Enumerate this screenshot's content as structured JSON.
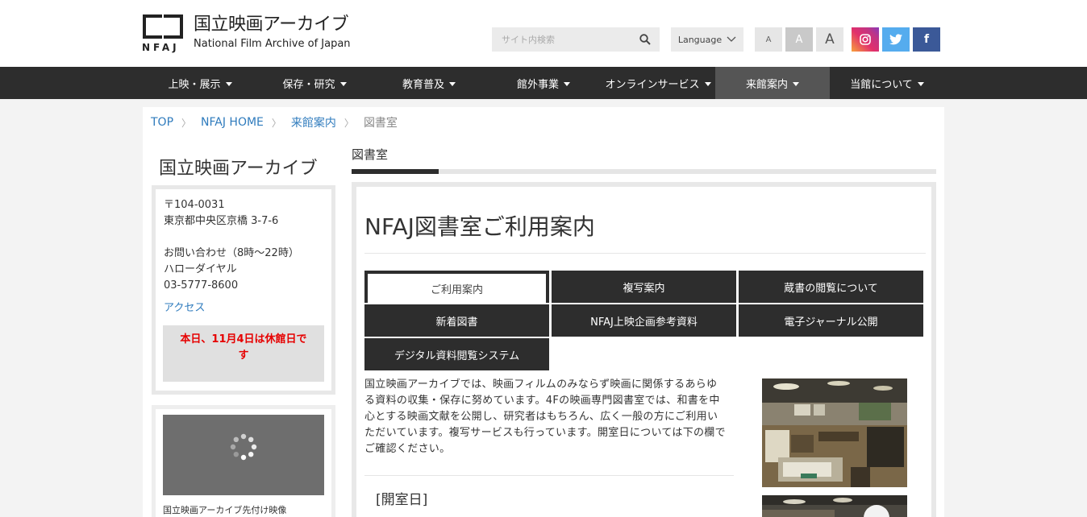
{
  "header": {
    "logo_jp": "国立映画アーカイブ",
    "logo_en": "National Film Archive of Japan",
    "logo_mark": "NFAJ",
    "search_placeholder": "サイト内検索",
    "language_label": "Language",
    "font_small": "A",
    "font_medium": "A",
    "font_large": "A",
    "sns": {
      "facebook": "f"
    }
  },
  "nav": [
    {
      "label": "上映・展示"
    },
    {
      "label": "保存・研究"
    },
    {
      "label": "教育普及"
    },
    {
      "label": "館外事業"
    },
    {
      "label": "オンラインサービス"
    },
    {
      "label": "来館案内"
    },
    {
      "label": "当館について"
    }
  ],
  "breadcrumb": {
    "top": "TOP",
    "home": "NFAJ HOME",
    "visit": "来館案内",
    "current": "図書室"
  },
  "sidebar": {
    "title": "国立映画アーカイブ",
    "postal": "〒104-0031",
    "address": "東京都中央区京橋 3-7-6",
    "contact_label": "お問い合わせ（8時～22時）",
    "dial": "ハローダイヤル",
    "phone": "03-5777-8600",
    "access": "アクセス",
    "closed_line1": "本日、11月4日は休館日で",
    "closed_line2": "す",
    "video_caption": "国立映画アーカイブ先付け映像"
  },
  "main": {
    "tab_title": "図書室",
    "heading": "NFAJ図書室ご利用案内",
    "buttons": [
      {
        "label": "ご利用案内"
      },
      {
        "label": "複写案内"
      },
      {
        "label": "蔵書の閲覧について"
      },
      {
        "label": "新着図書"
      },
      {
        "label": "NFAJ上映企画参考資料"
      },
      {
        "label": "電子ジャーナル公開"
      },
      {
        "label": "デジタル資料閲覧システム"
      }
    ],
    "intro": "国立映画アーカイブでは、映画フィルムのみならず映画に関係するあらゆる資料の収集・保存に努めています。4Fの映画専門図書室では、和書を中心とする映画文献を公開し、研究者はもちろん、広く一般の方にご利用いただいています。複写サービスも行っています。開室日については下の欄でご確認ください。",
    "section_heading": "[開室日]"
  },
  "colors": {
    "nav_bg": "#2d2d2d",
    "link": "#2f7bbd",
    "closed_text": "#e60000"
  }
}
